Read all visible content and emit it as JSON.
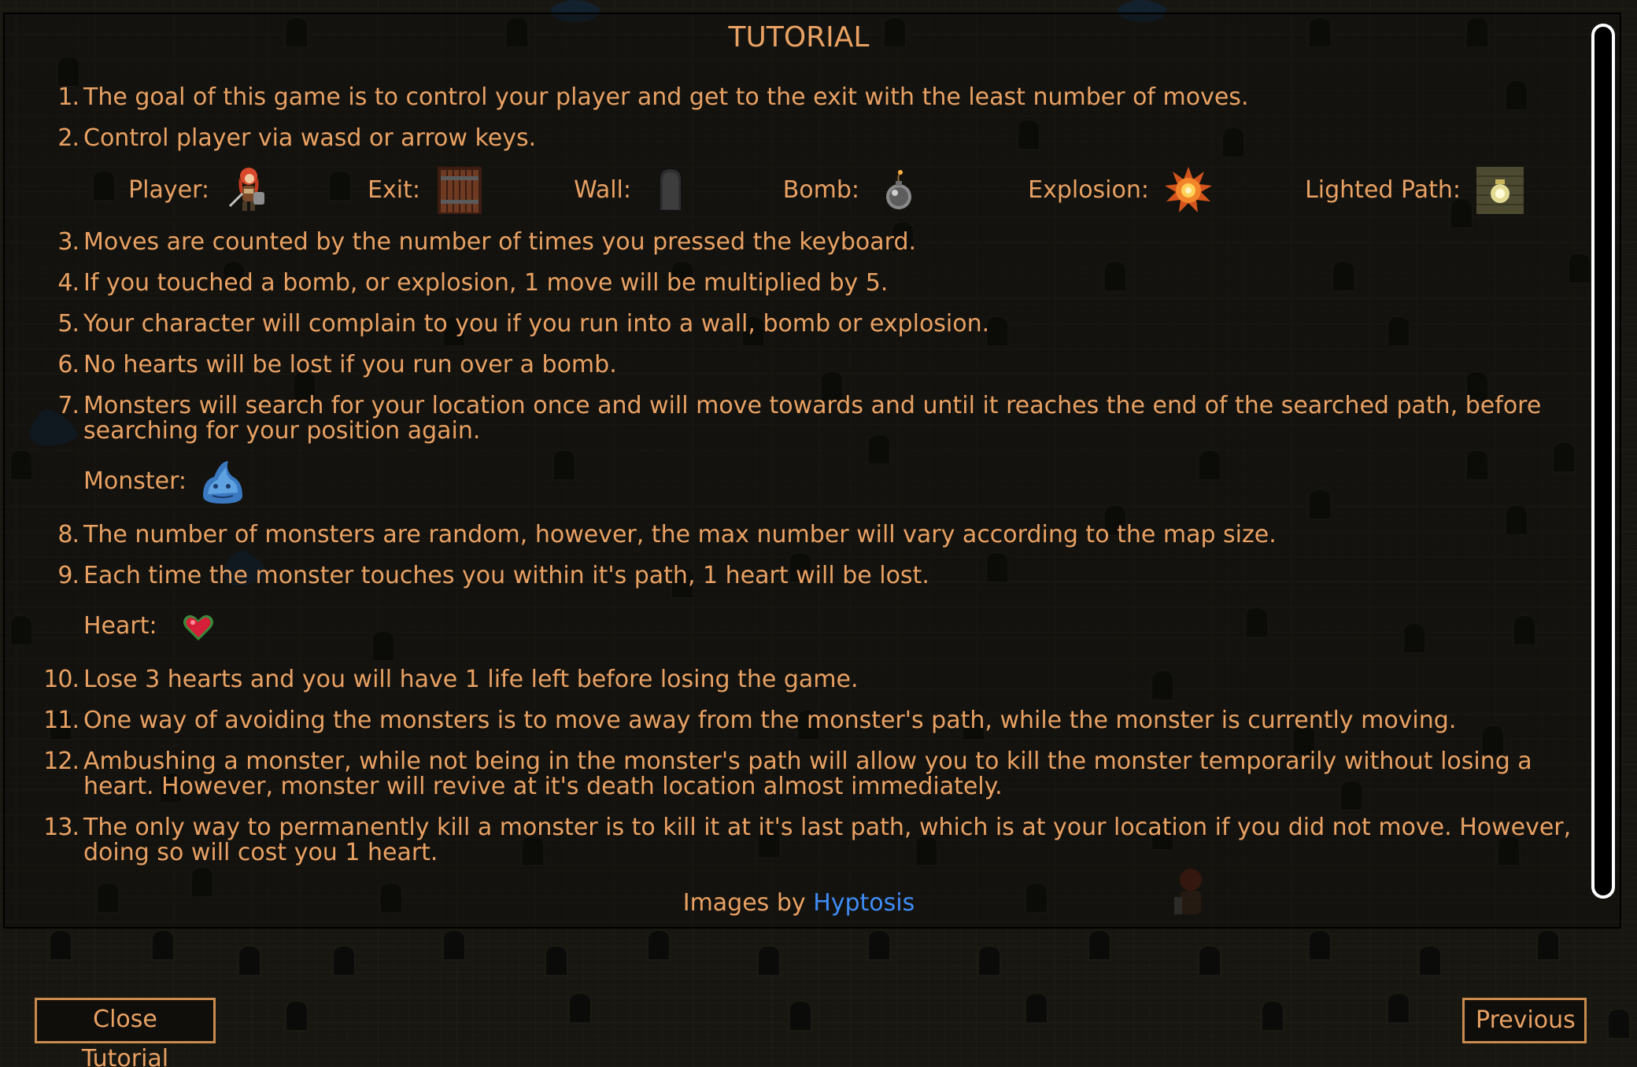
{
  "tutorial": {
    "title": "TUTORIAL",
    "steps": [
      {
        "num": "1.",
        "text": "The goal of this game is to control your player and get to the exit with the least number of moves."
      },
      {
        "num": "2.",
        "text": "Control player via wasd or arrow keys."
      },
      {
        "num": "3.",
        "text": "Moves are counted by the number of times you pressed the keyboard."
      },
      {
        "num": "4.",
        "text": "If you touched a bomb, or explosion, 1 move will be multiplied by 5."
      },
      {
        "num": "5.",
        "text": "Your character will complain to you if you run into a wall, bomb or explosion."
      },
      {
        "num": "6.",
        "text": "No hearts will be lost if you run over a bomb."
      },
      {
        "num": "7.",
        "text": "Monsters will search for your location once and will move towards and until it reaches the end of the searched path, before searching for your position again."
      },
      {
        "num": "8.",
        "text": "The number of monsters are random, however, the max number will vary according to the map size."
      },
      {
        "num": "9.",
        "text": "Each time the monster touches you within it's path, 1 heart will be lost."
      },
      {
        "num": "10.",
        "text": "Lose 3 hearts and you will have 1 life left before losing the game."
      },
      {
        "num": "11.",
        "text": "One way of avoiding the monsters is to move away from the monster's path, while the monster is currently moving."
      },
      {
        "num": "12.",
        "text": "Ambushing a monster, while not being in the monster's path will allow you to kill the monster temporarily without losing a heart. However, monster will revive at it's death location almost immediately."
      },
      {
        "num": "13.",
        "text": "The only way to permanently kill a monster is to kill it at it's last path, which is at your location if you did not move. However, doing so will cost you 1 heart."
      }
    ],
    "legend": {
      "player": "Player:",
      "exit": "Exit:",
      "wall": "Wall:",
      "bomb": "Bomb:",
      "explosion": "Explosion:",
      "lighted_path": "Lighted Path:",
      "monster": "Monster:",
      "heart": "Heart:"
    },
    "credits": {
      "prefix": "Images by",
      "link": "Hyptosis"
    }
  },
  "buttons": {
    "close": "Close Tutorial",
    "previous": "Previous"
  },
  "icons": [
    "player-icon",
    "exit-door-icon",
    "wall-tombstone-icon",
    "bomb-icon",
    "explosion-icon",
    "lighted-path-lantern-icon",
    "slime-monster-icon",
    "heart-icon"
  ],
  "colors": {
    "text": "#e9a163",
    "link": "#3f8cf6",
    "background": "#171611",
    "button_border": "#c98b4e"
  }
}
